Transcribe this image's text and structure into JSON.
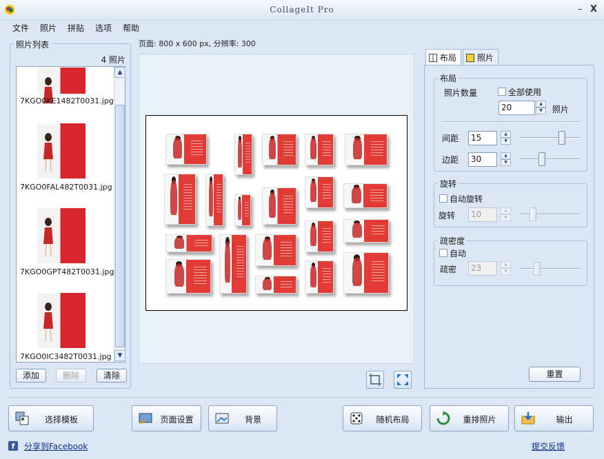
{
  "window": {
    "title": "CollageIt Pro",
    "minimize": "–",
    "close": "X"
  },
  "menu": [
    "文件",
    "照片",
    "拼贴",
    "选项",
    "帮助"
  ],
  "photo_list": {
    "title": "照片列表",
    "count": "4 照片",
    "items": [
      {
        "name": "7KGO0KE1482T0031.jpg"
      },
      {
        "name": "7KGO0FAL482T0031.jpg"
      },
      {
        "name": "7KGO0GPT482T0031.jpg"
      },
      {
        "name": "7KGO0IC3482T0031.jpg"
      }
    ],
    "add_label": "添加",
    "delete_label": "删除",
    "clear_label": "清除"
  },
  "page_info": "页面: 800 x 600 px, 分辨率: 300",
  "tabs": {
    "layout": "布局",
    "photo": "照片"
  },
  "layout": {
    "group_title": "布局",
    "photo_count_label": "照片数量",
    "use_all_label": "全部使用",
    "use_all_checked": false,
    "photo_count_value": "20",
    "photo_unit": "照片",
    "spacing_label": "间距",
    "spacing_value": "15",
    "spacing_level": 0.72,
    "margin_label": "边距",
    "margin_value": "30",
    "margin_level": 0.35
  },
  "rotation": {
    "group_title": "旋转",
    "auto_label": "自动旋转",
    "auto_checked": false,
    "rotate_label": "旋转",
    "value": "10",
    "level": 0.18
  },
  "density": {
    "group_title": "疏密度",
    "auto_label": "自动",
    "auto_checked": false,
    "label": "疏密",
    "value": "23",
    "level": 0.25
  },
  "reset_label": "重置",
  "bottom": {
    "choose_template": "选择模板",
    "page_setup": "页面设置",
    "background": "背景",
    "random_layout": "随机布局",
    "shuffle_photos": "重排照片",
    "export": "输出",
    "share_facebook": "分享到Facebook",
    "feedback": "提交反馈"
  },
  "colors": {
    "accent": "#d7262c",
    "panel": "#dbe7f5",
    "border": "#9fb6d6"
  }
}
